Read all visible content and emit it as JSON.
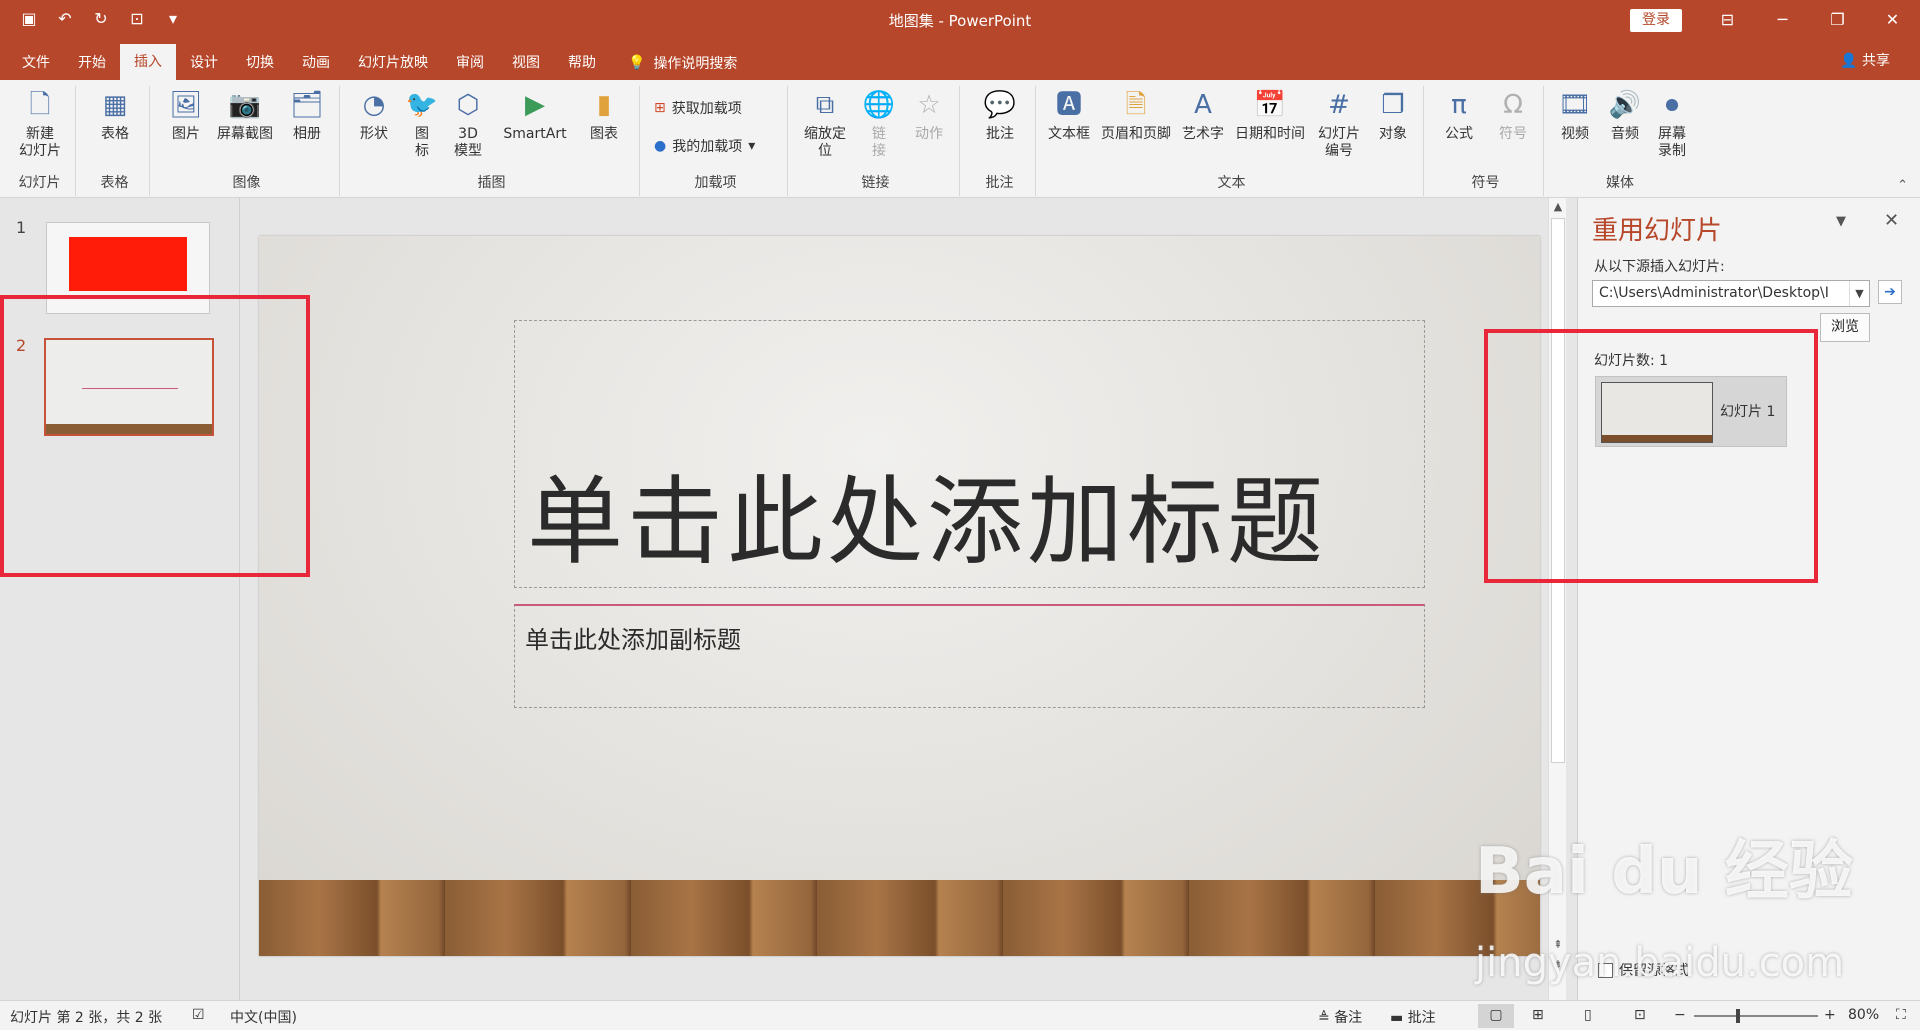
{
  "titlebar": {
    "title": "地图集  -  PowerPoint",
    "login": "登录"
  },
  "tabs": [
    "文件",
    "开始",
    "插入",
    "设计",
    "切换",
    "动画",
    "幻灯片放映",
    "审阅",
    "视图",
    "帮助"
  ],
  "tellme": "操作说明搜索",
  "share": "共享",
  "ribbon": {
    "new_slide_1": "新建",
    "new_slide_2": "幻灯片",
    "table": "表格",
    "picture": "图片",
    "screenshot": "屏幕截图",
    "album": "相册",
    "shapes": "形状",
    "icons_1": "图",
    "icons_2": "标",
    "model_1": "3D",
    "model_2": "模型",
    "smartart": "SmartArt",
    "chart": "图表",
    "get_addins": "获取加载项",
    "my_addins": "我的加载项",
    "zoom_1": "缩放定",
    "zoom_2": "位",
    "link_1": "链",
    "link_2": "接",
    "action": "动作",
    "comment": "批注",
    "textbox": "文本框",
    "header_footer": "页眉和页脚",
    "wordart": "艺术字",
    "datetime": "日期和时间",
    "slide_num_1": "幻灯片",
    "slide_num_2": "编号",
    "object": "对象",
    "equation": "公式",
    "symbol": "符号",
    "video": "视频",
    "audio": "音频",
    "screen_rec_1": "屏幕",
    "screen_rec_2": "录制"
  },
  "groups": [
    "幻灯片",
    "表格",
    "图像",
    "插图",
    "加载项",
    "链接",
    "批注",
    "文本",
    "符号",
    "媒体"
  ],
  "thumbnails": {
    "num1": "1",
    "num2": "2"
  },
  "slide": {
    "title": "单击此处添加标题",
    "subtitle": "单击此处添加副标题"
  },
  "reuse": {
    "title": "重用幻灯片",
    "source_label": "从以下源插入幻灯片:",
    "path": "C:\\Users\\Administrator\\Desktop\\I",
    "browse": "浏览",
    "count": "幻灯片数: 1",
    "item": "幻灯片 1",
    "keep_format": "保留源格式"
  },
  "status": {
    "slide_info": "幻灯片 第 2 张，共 2 张",
    "language": "中文(中国)",
    "notes": "备注",
    "comments": "批注",
    "zoom": "80%"
  },
  "watermark": {
    "line1": "Bai du 经验",
    "line2": "jingyan.baidu.com"
  }
}
